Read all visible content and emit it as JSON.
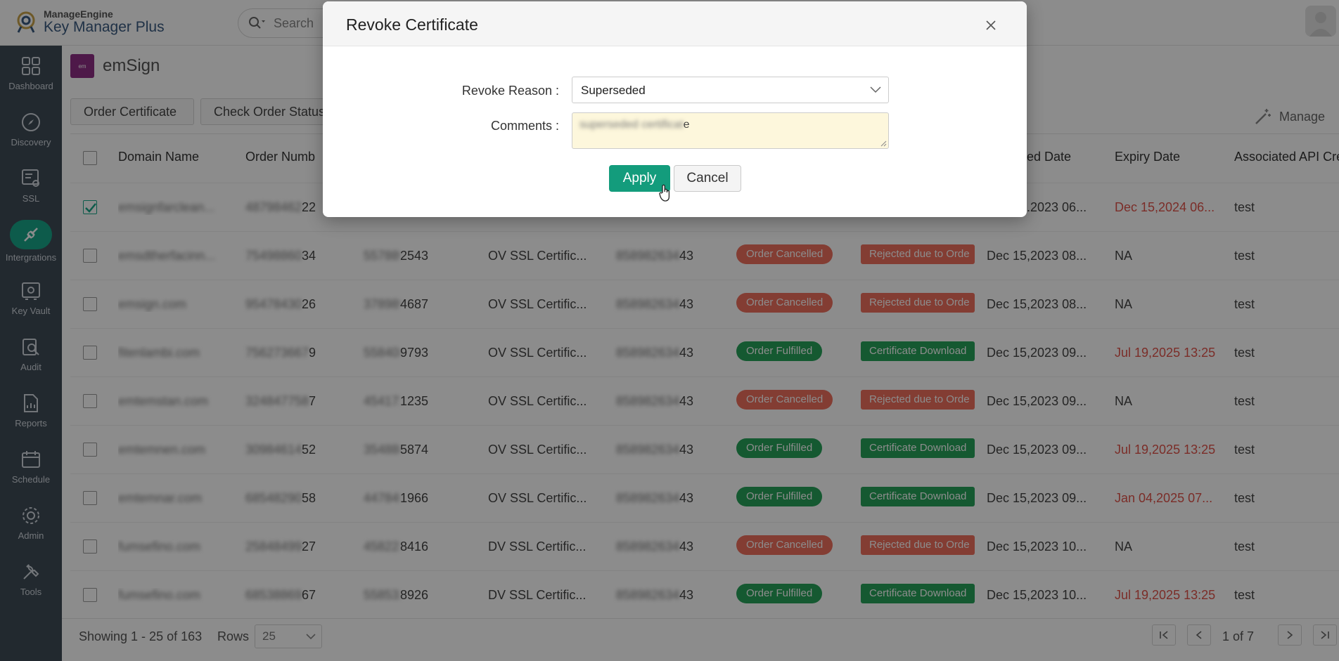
{
  "app": {
    "vendor": "ManageEngine",
    "product": "Key Manager Plus"
  },
  "search": {
    "placeholder": "Search"
  },
  "sidebar": {
    "items": [
      {
        "label": "Dashboard",
        "icon": "dashboard-icon"
      },
      {
        "label": "Discovery",
        "icon": "compass-icon"
      },
      {
        "label": "SSL",
        "icon": "certificate-icon"
      },
      {
        "label": "Intergrations",
        "icon": "integrations-icon",
        "active": true
      },
      {
        "label": "Key Vault",
        "icon": "vault-icon"
      },
      {
        "label": "Audit",
        "icon": "audit-icon"
      },
      {
        "label": "Reports",
        "icon": "reports-icon"
      },
      {
        "label": "Schedule",
        "icon": "calendar-icon"
      },
      {
        "label": "Admin",
        "icon": "gear-icon"
      },
      {
        "label": "Tools",
        "icon": "tools-icon"
      }
    ]
  },
  "page": {
    "brand": "emSign"
  },
  "toolbar": {
    "order_certificate": "Order Certificate",
    "check_order_status": "Check Order Status",
    "manage": "Manage"
  },
  "table": {
    "headers": {
      "domain": "Domain Name",
      "order_number": "Order Numb",
      "revoked_date": "ed Date",
      "expiry": "Expiry Date",
      "api": "Associated API Cre"
    },
    "rows": [
      {
        "domain": "emsignfarclean...",
        "order": "4879846222",
        "order_vis": "22",
        "sub": "",
        "sub_vis": "",
        "type": "",
        "account": "",
        "account_vis": "",
        "status": "",
        "detail": "",
        "ordered": "Dec 15,2023 06...",
        "ordered_vis": ".2023 06...",
        "expiry": "Dec 15,2024 06...",
        "api": "test",
        "checked": true
      },
      {
        "domain": "emsdtherfacinn...",
        "order": "7549886034",
        "order_vis": "34",
        "sub": "5578892543",
        "sub_vis": "2543",
        "type": "OV SSL Certific...",
        "account": "8589826343",
        "account_vis": "43",
        "status": "Order Cancelled",
        "detail": "Rejected due to Orde",
        "ordered": "Dec 15,2023 08...",
        "expiry": "NA",
        "api": "test"
      },
      {
        "domain": "emsign.com",
        "order": "9547843026",
        "order_vis": "26",
        "sub": "3789894687",
        "sub_vis": "4687",
        "type": "OV SSL Certific...",
        "account": "8589826343",
        "account_vis": "43",
        "status": "Order Cancelled",
        "detail": "Rejected due to Orde",
        "ordered": "Dec 15,2023 08...",
        "expiry": "NA",
        "api": "test"
      },
      {
        "domain": "fitenlambi.com",
        "order": "7562736679",
        "order_vis": "9",
        "sub": "5584089793",
        "sub_vis": "9793",
        "type": "OV SSL Certific...",
        "account": "8589826343",
        "account_vis": "43",
        "status": "Order Fulfilled",
        "detail": "Certificate Download",
        "ordered": "Dec 15,2023 09...",
        "expiry": "Jul 19,2025 13:25",
        "api": "test"
      },
      {
        "domain": "emtemstan.com",
        "order": "3248477587",
        "order_vis": "7",
        "sub": "4541721235",
        "sub_vis": "1235",
        "type": "OV SSL Certific...",
        "account": "8589826343",
        "account_vis": "43",
        "status": "Order Cancelled",
        "detail": "Rejected due to Orde",
        "ordered": "Dec 15,2023 09...",
        "expiry": "NA",
        "api": "test"
      },
      {
        "domain": "emtemnen.com",
        "order": "3098461452",
        "order_vis": "52",
        "sub": "3548885874",
        "sub_vis": "5874",
        "type": "OV SSL Certific...",
        "account": "8589826343",
        "account_vis": "43",
        "status": "Order Fulfilled",
        "detail": "Certificate Download",
        "ordered": "Dec 15,2023 09...",
        "expiry": "Jul 19,2025 13:25",
        "api": "test"
      },
      {
        "domain": "emtemnar.com",
        "order": "6854829058",
        "order_vis": "58",
        "sub": "4478451966",
        "sub_vis": "1966",
        "type": "OV SSL Certific...",
        "account": "8589826343",
        "account_vis": "43",
        "status": "Order Fulfilled",
        "detail": "Certificate Download",
        "ordered": "Dec 15,2023 09...",
        "expiry": "Jan 04,2025 07...",
        "api": "test"
      },
      {
        "domain": "fumsefino.com",
        "order": "2584849927",
        "order_vis": "27",
        "sub": "4582238416",
        "sub_vis": "8416",
        "type": "DV SSL Certific...",
        "account": "8589826343",
        "account_vis": "43",
        "status": "Order Cancelled",
        "detail": "Rejected due to Orde",
        "ordered": "Dec 15,2023 10...",
        "expiry": "NA",
        "api": "test"
      },
      {
        "domain": "fumsefino.com",
        "order": "6853886967",
        "order_vis": "67",
        "sub": "5585328926",
        "sub_vis": "8926",
        "type": "DV SSL Certific...",
        "account": "8589826343",
        "account_vis": "43",
        "status": "Order Fulfilled",
        "detail": "Certificate Download",
        "ordered": "Dec 15,2023 10...",
        "expiry": "Jul 19,2025 13:25",
        "api": "test"
      }
    ]
  },
  "footer": {
    "showing": "Showing 1 - 25 of 163",
    "rows_label": "Rows",
    "rows_value": "25",
    "page": "1 of 7"
  },
  "modal": {
    "title": "Revoke Certificate",
    "reason_label": "Revoke Reason :",
    "reason_value": "Superseded",
    "comments_label": "Comments :",
    "comments_blurred": "superseded certificat",
    "comments_tail": "e",
    "apply": "Apply",
    "cancel": "Cancel"
  },
  "colors": {
    "accent": "#19a789",
    "sidebar": "#3f4b57",
    "danger": "#e0534a",
    "success": "#27a35a"
  }
}
